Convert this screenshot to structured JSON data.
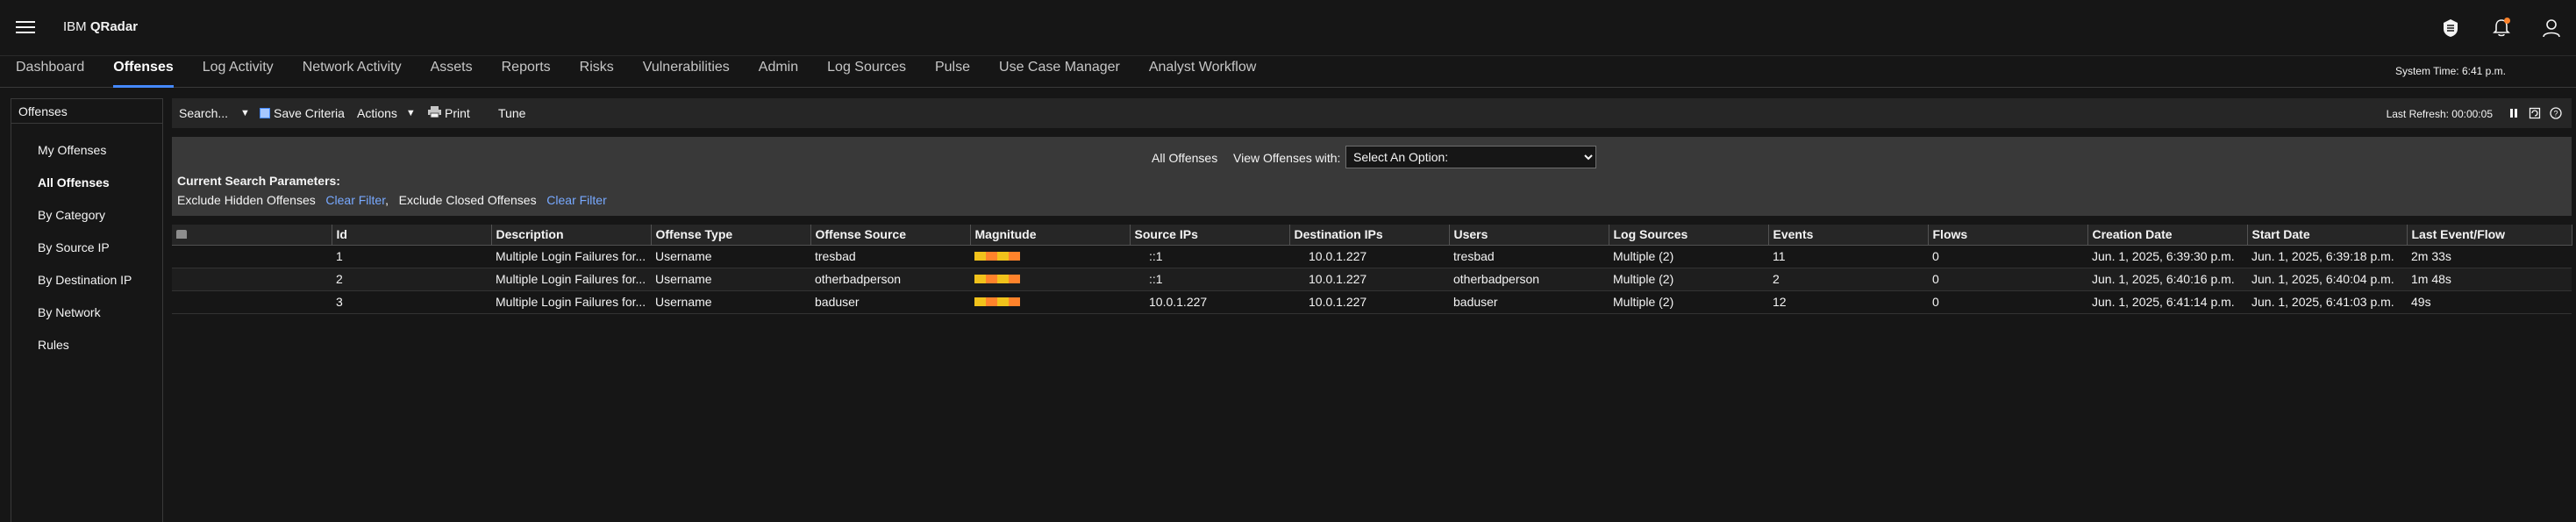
{
  "header": {
    "brand_prefix": "IBM ",
    "brand_name": "QRadar",
    "icons": [
      "menu-icon",
      "shield-app-icon",
      "notification-icon",
      "user-icon"
    ],
    "notification_dot_color": "#ff832b"
  },
  "nav": {
    "tabs": [
      {
        "label": "Dashboard"
      },
      {
        "label": "Offenses",
        "active": true
      },
      {
        "label": "Log Activity"
      },
      {
        "label": "Network Activity"
      },
      {
        "label": "Assets"
      },
      {
        "label": "Reports"
      },
      {
        "label": "Risks"
      },
      {
        "label": "Vulnerabilities"
      },
      {
        "label": "Admin"
      },
      {
        "label": "Log Sources"
      },
      {
        "label": "Pulse"
      },
      {
        "label": "Use Case Manager"
      },
      {
        "label": "Analyst Workflow"
      }
    ],
    "system_time": "System Time: 6:41 p.m.",
    "accent_color": "#4589ff"
  },
  "sidebar": {
    "title": "Offenses",
    "items": [
      {
        "label": "My Offenses"
      },
      {
        "label": "All Offenses",
        "active": true
      },
      {
        "label": "By Category"
      },
      {
        "label": "By Source IP"
      },
      {
        "label": "By Destination IP"
      },
      {
        "label": "By Network"
      },
      {
        "label": "Rules"
      }
    ]
  },
  "toolbar": {
    "search_label": "Search...",
    "save_criteria_label": "Save Criteria",
    "actions_label": "Actions",
    "print_label": "Print",
    "tune_label": "Tune",
    "last_refresh": "Last Refresh: 00:00:05",
    "right_icons": [
      "pause-icon",
      "refresh-icon",
      "help-icon"
    ]
  },
  "filters": {
    "all_offenses_label": "All Offenses",
    "view_with_label": "View Offenses with:",
    "view_select_value": "Select An Option:",
    "current_params_label": "Current Search Parameters:",
    "filter1_label": "Exclude Hidden Offenses",
    "filter1_clear": "Clear Filter",
    "separator": ",",
    "filter2_label": "Exclude Closed Offenses",
    "filter2_clear": "Clear Filter",
    "link_color": "#78a9ff"
  },
  "table": {
    "columns": [
      "",
      "Id",
      "Description",
      "Offense Type",
      "Offense Source",
      "Magnitude",
      "Source IPs",
      "Destination IPs",
      "Users",
      "Log Sources",
      "Events",
      "Flows",
      "Creation Date",
      "Start Date",
      "Last Event/Flow"
    ],
    "magnitude_colors": [
      "#f1c21b",
      "#ff832b",
      "#f1c21b",
      "#ff832b"
    ],
    "rows": [
      {
        "id": "1",
        "description": "Multiple Login Failures for...",
        "offense_type": "Username",
        "offense_source": "tresbad",
        "source_ips": "::1",
        "destination_ips": "10.0.1.227",
        "users": "tresbad",
        "log_sources": "Multiple (2)",
        "events": "11",
        "flows": "0",
        "creation_date": "Jun. 1, 2025, 6:39:30 p.m.",
        "start_date": "Jun. 1, 2025, 6:39:18 p.m.",
        "last_event_flow": "2m 33s"
      },
      {
        "id": "2",
        "description": "Multiple Login Failures for...",
        "offense_type": "Username",
        "offense_source": "otherbadperson",
        "source_ips": "::1",
        "destination_ips": "10.0.1.227",
        "users": "otherbadperson",
        "log_sources": "Multiple (2)",
        "events": "2",
        "flows": "0",
        "creation_date": "Jun. 1, 2025, 6:40:16 p.m.",
        "start_date": "Jun. 1, 2025, 6:40:04 p.m.",
        "last_event_flow": "1m 48s"
      },
      {
        "id": "3",
        "description": "Multiple Login Failures for...",
        "offense_type": "Username",
        "offense_source": "baduser",
        "source_ips": "10.0.1.227",
        "destination_ips": "10.0.1.227",
        "users": "baduser",
        "log_sources": "Multiple (2)",
        "events": "12",
        "flows": "0",
        "creation_date": "Jun. 1, 2025, 6:41:14 p.m.",
        "start_date": "Jun. 1, 2025, 6:41:03 p.m.",
        "last_event_flow": "49s"
      }
    ]
  }
}
